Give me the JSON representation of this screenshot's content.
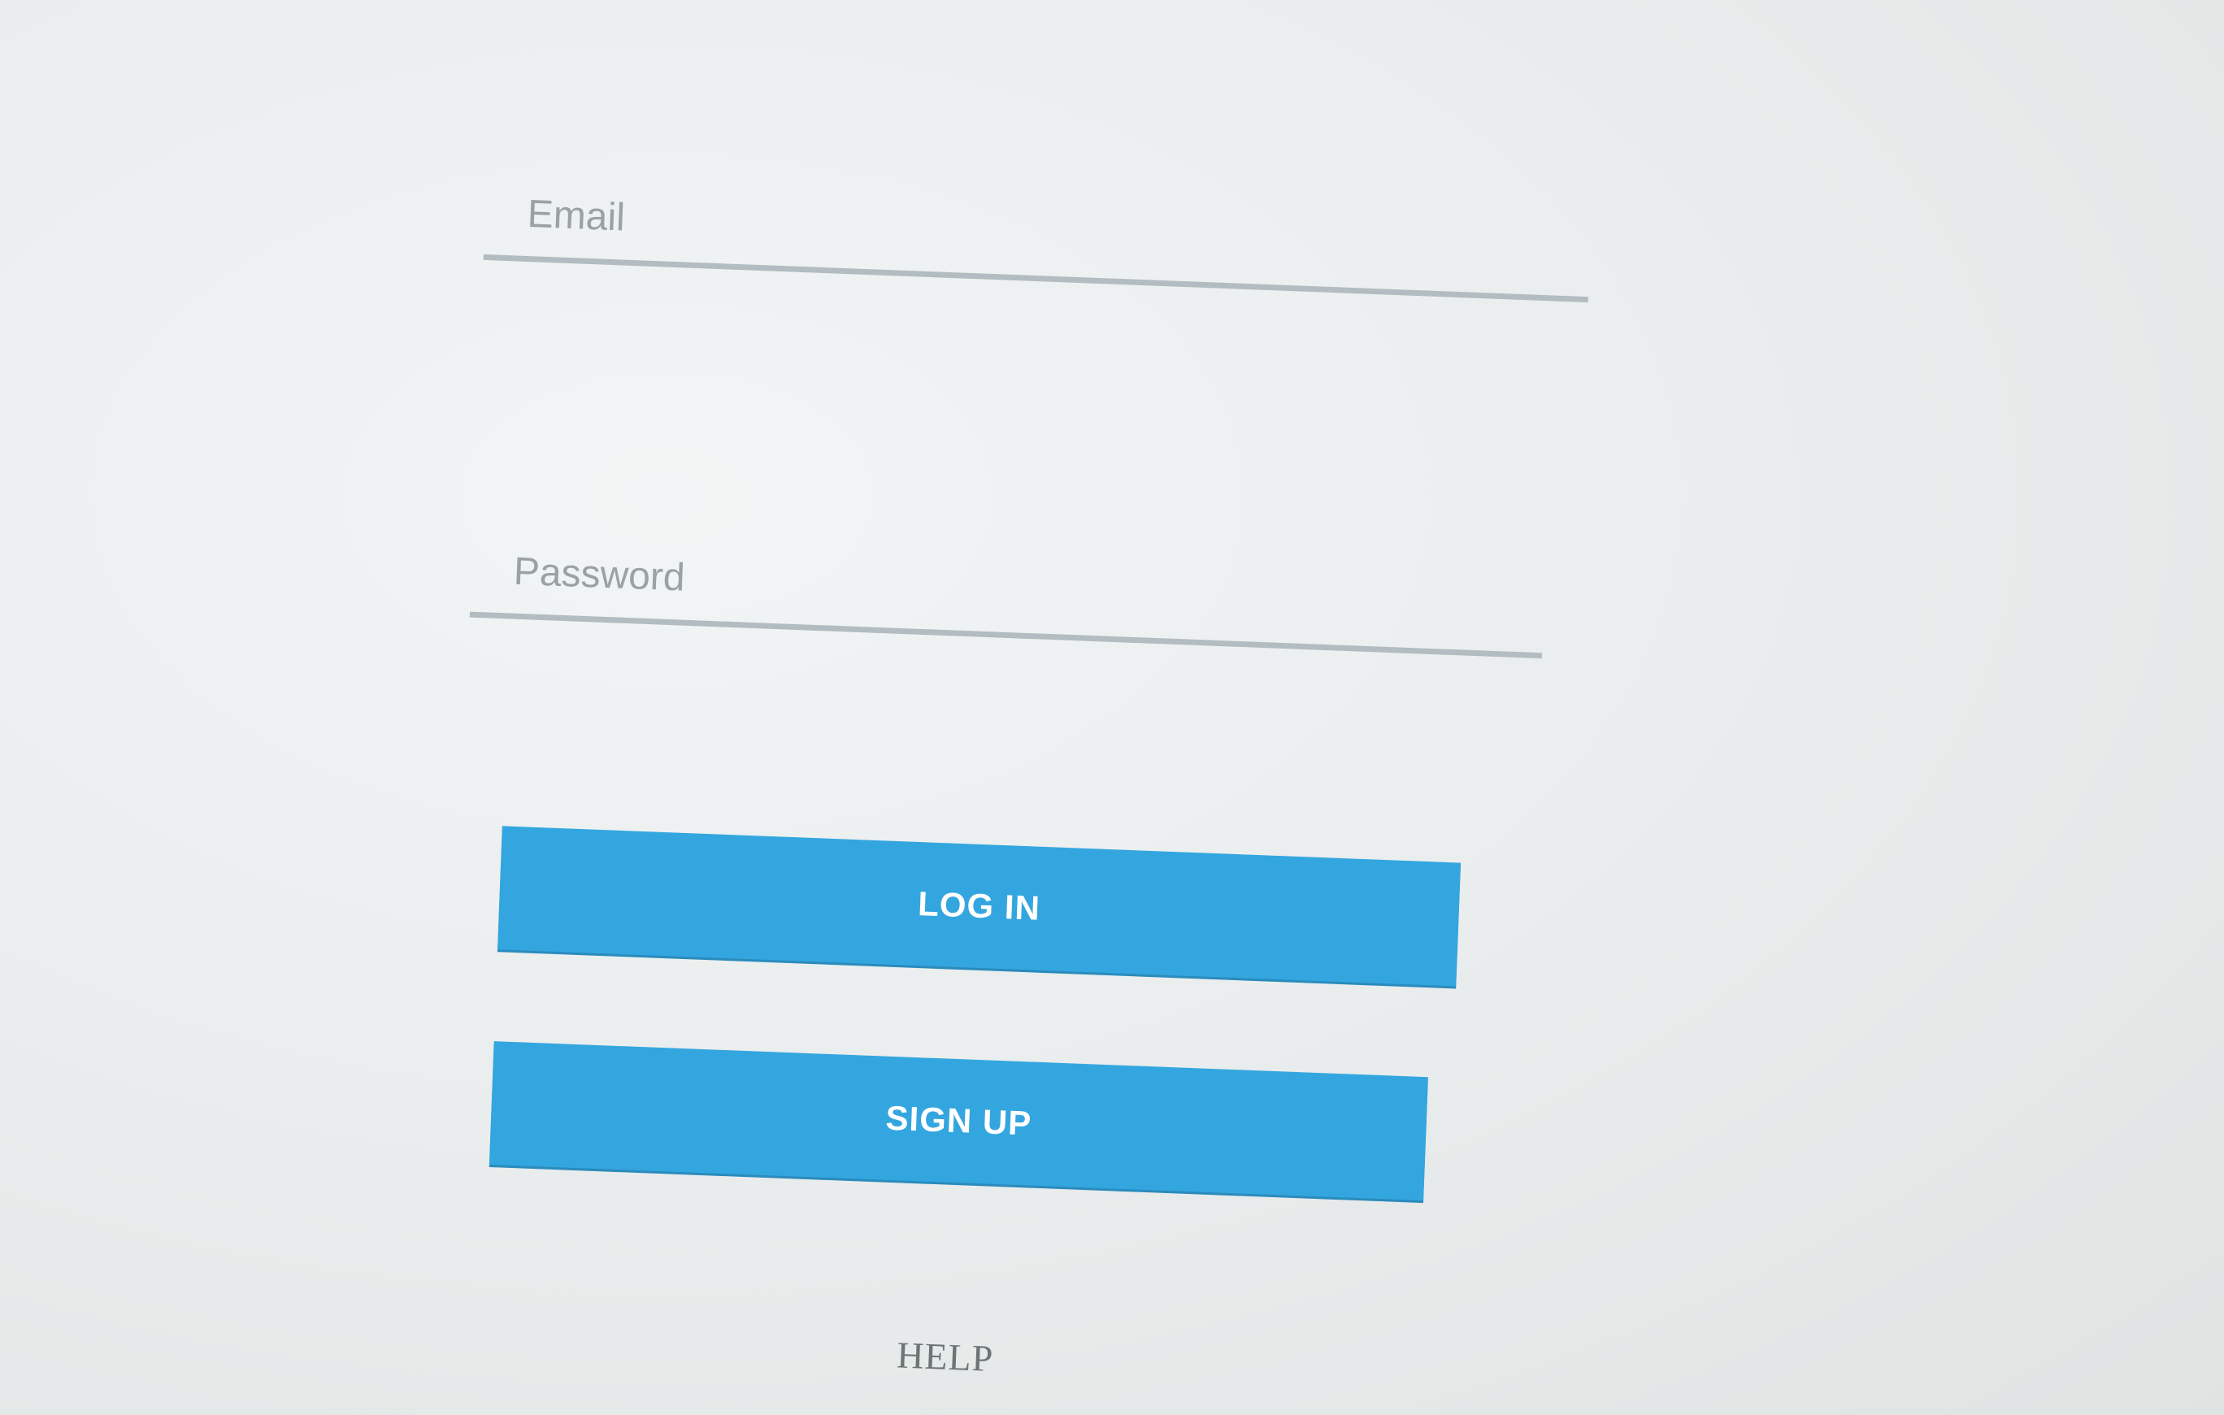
{
  "login_form": {
    "email": {
      "placeholder": "Email",
      "value": ""
    },
    "password": {
      "placeholder": "Password",
      "value": ""
    },
    "login_button_label": "LOG IN",
    "signup_button_label": "SIGN UP",
    "help_link_label": "HELP"
  },
  "colors": {
    "button_background": "#34a6df",
    "button_text": "#ffffff",
    "field_underline": "#b3bcc0",
    "placeholder_text": "#9aa2a4",
    "background": "#e9ecec"
  }
}
